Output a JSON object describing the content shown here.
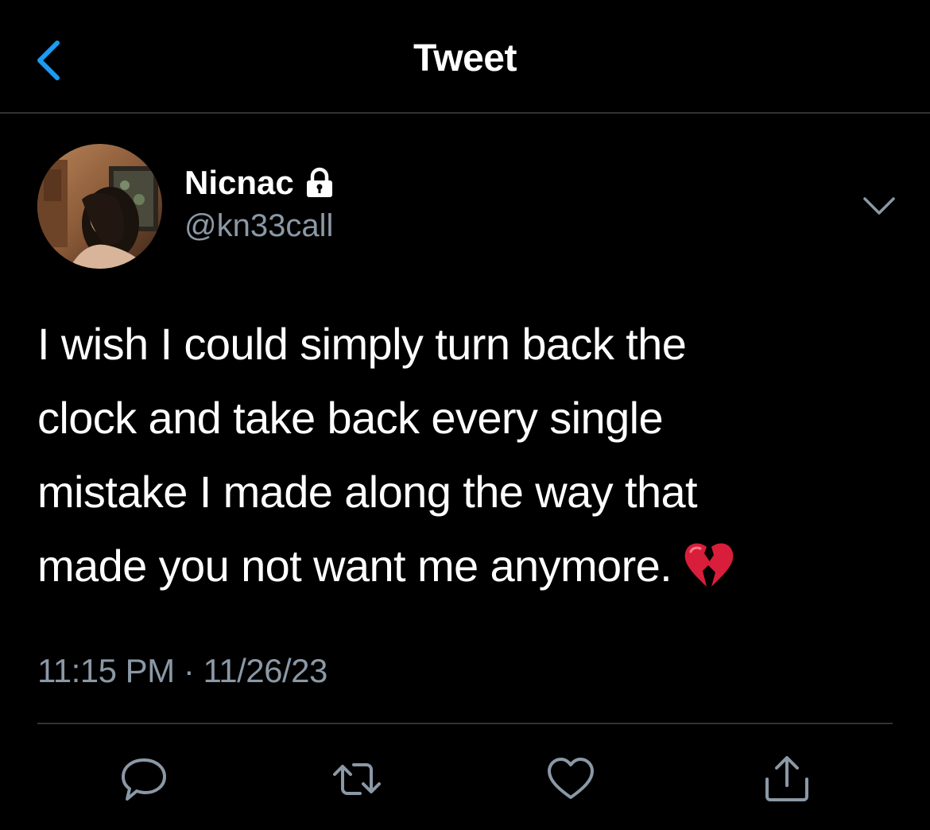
{
  "header": {
    "title": "Tweet",
    "back_icon": "chevron-left-icon",
    "accent": "#1d9bf0"
  },
  "author": {
    "display_name": "Nicnac",
    "handle": "@kn33call",
    "protected_icon": "lock-icon"
  },
  "tweet": {
    "lines": [
      "I wish I could simply turn back the",
      "clock and take back every single",
      "mistake I made along the way that",
      "made you not want me anymore."
    ],
    "emoji": "broken-heart-icon",
    "timestamp": "11:15 PM · 11/26/23"
  },
  "actions": [
    {
      "icon": "reply-icon"
    },
    {
      "icon": "retweet-icon"
    },
    {
      "icon": "like-icon"
    },
    {
      "icon": "share-icon"
    }
  ],
  "colors": {
    "background": "#000000",
    "text": "#ffffff",
    "secondary": "#8b98a5",
    "divider": "#2f3336",
    "emoji_red": "#d81e3a"
  }
}
